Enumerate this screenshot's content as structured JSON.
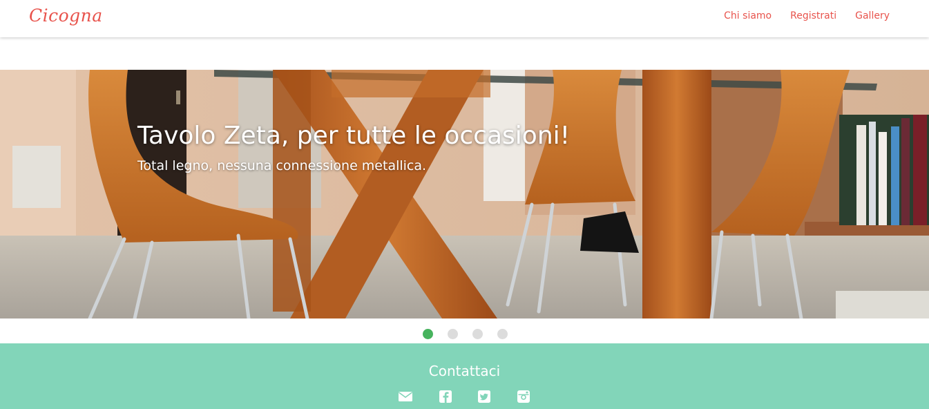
{
  "navbar": {
    "brand": "Cicogna",
    "links": [
      {
        "label": "Chi siamo"
      },
      {
        "label": "Registrati"
      },
      {
        "label": "Gallery"
      }
    ]
  },
  "carousel": {
    "caption_title": "Tavolo Zeta, per tutte le occasioni!",
    "caption_subtitle": "Total legno, nessuna connessione metallica.",
    "slide_count": 4,
    "active_index": 0,
    "indicators": [
      "slide-1",
      "slide-2",
      "slide-3",
      "slide-4"
    ]
  },
  "footer": {
    "title": "Contattaci",
    "socials": [
      "envelope-icon",
      "facebook-icon",
      "twitter-icon",
      "instagram-icon"
    ]
  },
  "colors": {
    "brand": "#e8534c",
    "indicator_active": "#47b35e",
    "indicator_inactive": "#dcdcdc",
    "footer_bg": "#82d5b9"
  }
}
